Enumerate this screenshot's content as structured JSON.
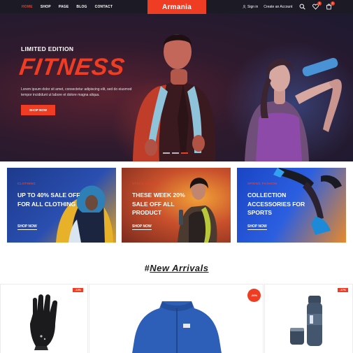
{
  "header": {
    "nav": [
      "HOME",
      "SHOP",
      "PAGE",
      "BLOG",
      "CONTACT"
    ],
    "logo": "Armania",
    "sign_in": "Sign in",
    "create_account": "Create an Account",
    "wishlist_count": "0",
    "cart_count": "0",
    "icons": [
      "user-icon",
      "search-icon",
      "heart-icon",
      "cart-icon"
    ]
  },
  "hero": {
    "kicker": "LIMITED EDITION",
    "title": "FITNESS",
    "description": "Lorem ipsum dolor sit amet, consectetur adipiscing elit, sed do eiusmod tempor incididunt ut labore et dolore magna aliqua.",
    "button": "SHOP NOW",
    "slide_count": 3,
    "active_slide": 3
  },
  "promos": [
    {
      "kicker": "CLOTHING",
      "title": "UP TO 40% SALE OFF FOR ALL CLOTHING",
      "link": "SHOP NOW"
    },
    {
      "kicker": "STOCK LIMITED",
      "title": "THESE WEEK 20% SALE OFF ALL PRODUCT",
      "link": "SHOP NOW"
    },
    {
      "kicker": "SPRING FASHION",
      "title": "COLLECTION ACCESSORIES FOR SPORTS",
      "link": "SHOP NOW"
    }
  ],
  "new_arrivals": {
    "hash": "#",
    "title": "New Arrivals",
    "products": [
      {
        "badge": "-13%",
        "image": "glove"
      },
      {
        "badge": "-30%",
        "image": "jacket"
      },
      {
        "badge": "-17%",
        "image": "flask"
      }
    ]
  },
  "colors": {
    "accent": "#ef3d23",
    "header_bg": "#1c1a24",
    "text_dark": "#1d1d1d"
  }
}
